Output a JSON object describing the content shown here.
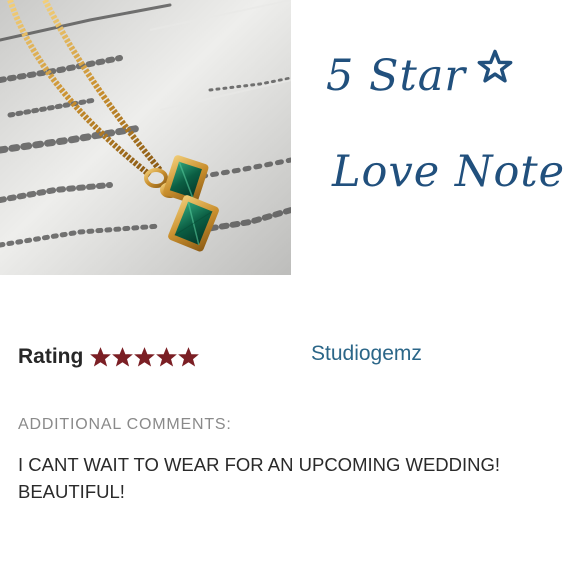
{
  "photo": {
    "subject": "gold chain necklace with two emerald-cut green gemstone pendants on a marble surface"
  },
  "headline": {
    "line1": "5 Star",
    "line1_icon": "star-outline-icon",
    "line2": "Love Note",
    "color": "#21507d"
  },
  "review": {
    "rating_label": "Rating",
    "rating_value": 5,
    "rating_max": 5,
    "star_color": "#7b1f24",
    "shop_name": "Studiogemz",
    "comments_heading": "ADDITIONAL COMMENTS:",
    "comment_text": "I CANT WAIT TO WEAR FOR AN UPCOMING WEDDING! BEAUTIFUL!"
  }
}
